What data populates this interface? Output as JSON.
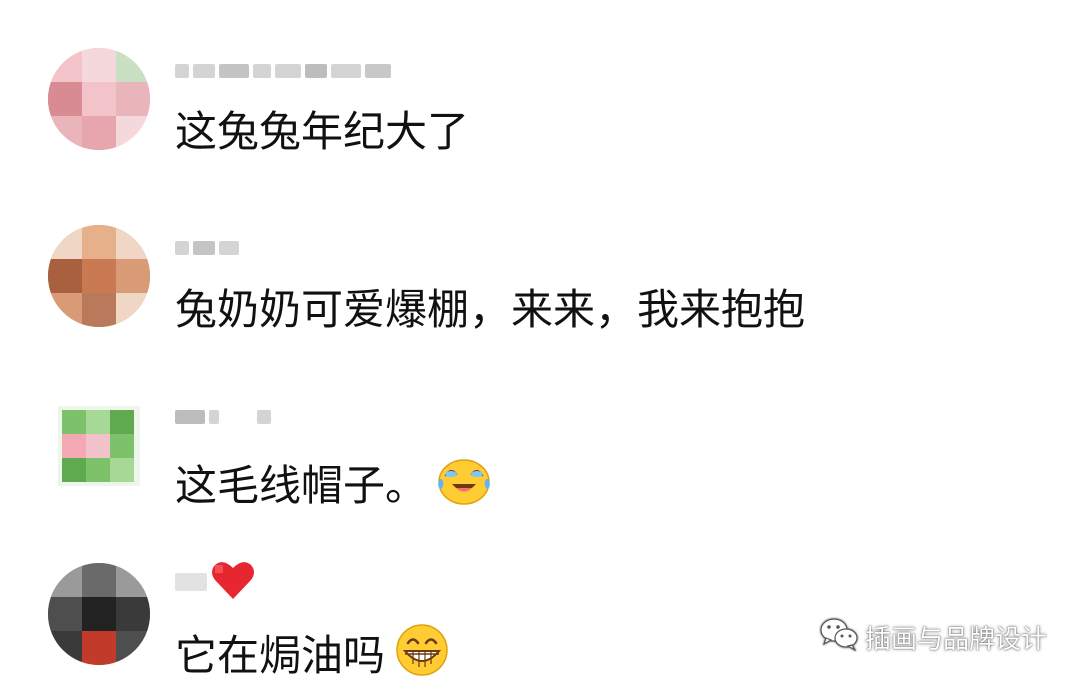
{
  "comments": [
    {
      "avatar_colors": [
        "#e7a5ad",
        "#f2c4c9",
        "#d98b94",
        "#c9e0c2",
        "#f5d8db",
        "#e9b5bb"
      ],
      "text": "这兔兔年纪大了",
      "emoji": null
    },
    {
      "avatar_colors": [
        "#c97a52",
        "#e6b08b",
        "#a8603f",
        "#f0d6c4",
        "#d99b76",
        "#b97a5c"
      ],
      "text": "兔奶奶可爱爆棚，来来，我来抱抱",
      "emoji": null
    },
    {
      "avatar_colors": [
        "#7dc26a",
        "#f4a8b4",
        "#5fa94f",
        "#eef5ea",
        "#a6d996",
        "#f2c2cb"
      ],
      "text": "这毛线帽子。",
      "emoji": "tears-of-joy-icon"
    },
    {
      "avatar_colors": [
        "#3a3a3a",
        "#6a6a6a",
        "#222222",
        "#9a9a9a",
        "#c23b2a",
        "#4e4e4e"
      ],
      "text": "它在焗油吗",
      "emoji": "grinning-icon",
      "name_badge": "red-heart-icon"
    }
  ],
  "watermark": {
    "icon": "wechat-icon",
    "text": "插画与品牌设计"
  },
  "colors": {
    "text": "#111111",
    "username_blur": "#d4d4d4",
    "heart": "#e8262f",
    "emoji_yellow": "#ffcc33"
  }
}
